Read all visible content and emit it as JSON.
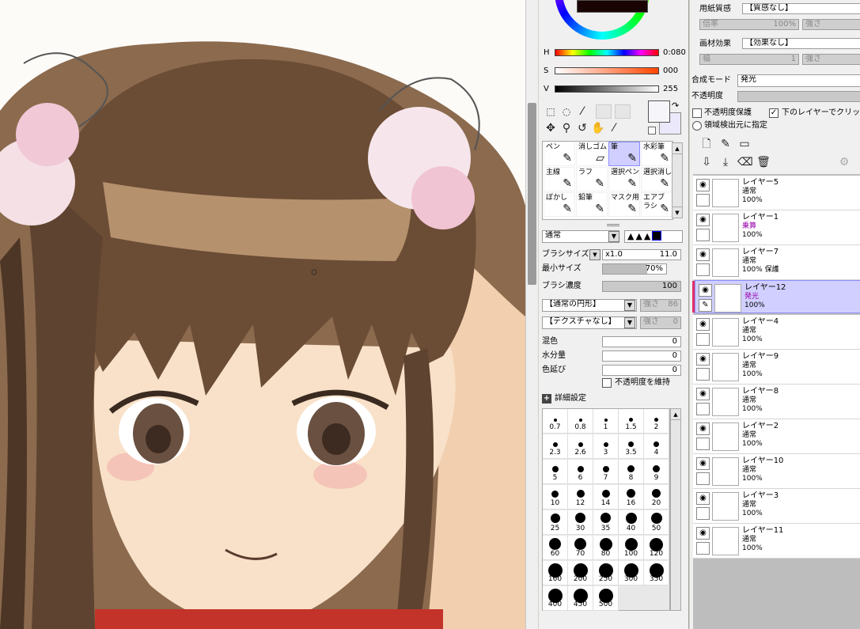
{
  "color": {
    "h_label": "H",
    "h_value": "0:080",
    "s_label": "S",
    "s_value": "000",
    "v_label": "V",
    "v_value": "255",
    "main_swatch": "#f6f5f9",
    "sub_swatch": "#ece8fb"
  },
  "tools": [
    {
      "label": "ペン",
      "glyph": "✎"
    },
    {
      "label": "消しゴム",
      "glyph": "▱"
    },
    {
      "label": "筆",
      "glyph": "✎"
    },
    {
      "label": "水彩筆",
      "glyph": "✎"
    },
    {
      "label": "主線",
      "glyph": "✎"
    },
    {
      "label": "ラフ",
      "glyph": "✎"
    },
    {
      "label": "選択ペン",
      "glyph": "✎"
    },
    {
      "label": "選択消し",
      "glyph": "✎"
    },
    {
      "label": "ぼかし",
      "glyph": "✎"
    },
    {
      "label": "鉛筆",
      "glyph": "✎"
    },
    {
      "label": "マスク用",
      "glyph": "✎"
    },
    {
      "label": "エアブラシ",
      "glyph": "✎"
    }
  ],
  "brush": {
    "blend_mode": "通常",
    "size_label": "ブラシサイズ",
    "size_mult": "x1.0",
    "size_value": "11.0",
    "min_size_label": "最小サイズ",
    "min_size_value": "70%",
    "density_label": "ブラシ濃度",
    "density_value": "100",
    "shape": "【通常の円形】",
    "shape_strength_label": "強さ",
    "shape_strength": "86",
    "texture": "【テクスチャなし】",
    "texture_strength_label": "強さ",
    "texture_strength": "0",
    "mix_label": "混色",
    "mix_value": "0",
    "water_label": "水分量",
    "water_value": "0",
    "stretch_label": "色延び",
    "stretch_value": "0",
    "keep_opacity_label": "不透明度を維持",
    "detail_label": "詳細設定",
    "sizes": [
      "0.7",
      "0.8",
      "1",
      "1.5",
      "2",
      "2.3",
      "2.6",
      "3",
      "3.5",
      "4",
      "5",
      "6",
      "7",
      "8",
      "9",
      "10",
      "12",
      "14",
      "16",
      "20",
      "25",
      "30",
      "35",
      "40",
      "50",
      "60",
      "70",
      "80",
      "100",
      "120",
      "160",
      "200",
      "250",
      "300",
      "350",
      "400",
      "450",
      "500"
    ]
  },
  "layerprops": {
    "paper_label": "用紙質感",
    "paper_value": "【質感なし】",
    "paper_scale_label": "倍率",
    "paper_scale_value": "100%",
    "paper_strength_label": "強さ",
    "effect_label": "画材効果",
    "effect_value": "【効果なし】",
    "effect_width_label": "幅",
    "effect_width_value": "1",
    "effect_strength_label": "強さ",
    "blend_label": "合成モード",
    "blend_value": "発光",
    "opacity_label": "不透明度",
    "protect_label": "不透明度保護",
    "clip_label": "下のレイヤーでクリッピング",
    "region_label": "領域検出元に指定"
  },
  "layers": [
    {
      "name": "レイヤー5",
      "mode": "通常",
      "opacity": "100%"
    },
    {
      "name": "レイヤー1",
      "mode": "乗算",
      "opacity": "100%"
    },
    {
      "name": "レイヤー7",
      "mode": "通常",
      "opacity": "100% 保護"
    },
    {
      "name": "レイヤー12",
      "mode": "発光",
      "opacity": "100%"
    },
    {
      "name": "レイヤー4",
      "mode": "通常",
      "opacity": "100%"
    },
    {
      "name": "レイヤー9",
      "mode": "通常",
      "opacity": "100%"
    },
    {
      "name": "レイヤー8",
      "mode": "通常",
      "opacity": "100%"
    },
    {
      "name": "レイヤー2",
      "mode": "通常",
      "opacity": "100%"
    },
    {
      "name": "レイヤー10",
      "mode": "通常",
      "opacity": "100%"
    },
    {
      "name": "レイヤー3",
      "mode": "通常",
      "opacity": "100%"
    },
    {
      "name": "レイヤー11",
      "mode": "通常",
      "opacity": "100%"
    }
  ],
  "colors": {
    "selected": "#d0cfff",
    "accent_mode": "#9900aa"
  }
}
